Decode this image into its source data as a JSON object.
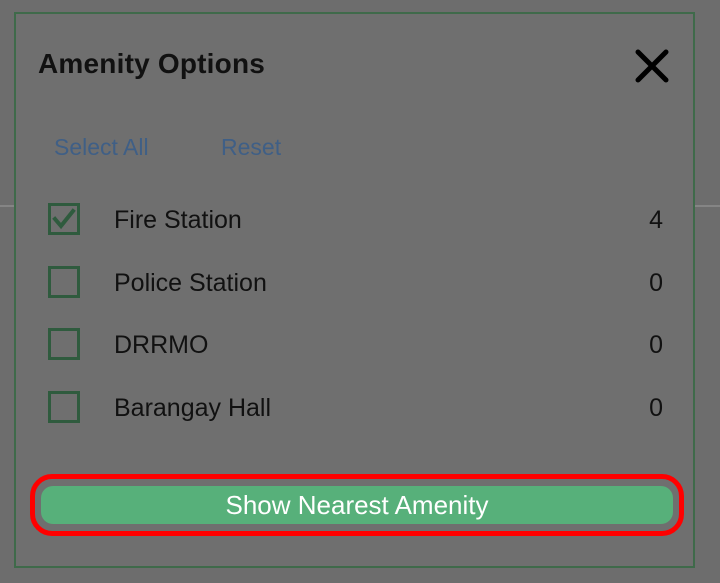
{
  "dialog": {
    "title": "Amenity Options",
    "select_all_label": "Select All",
    "reset_label": "Reset",
    "items": [
      {
        "label": "Fire Station",
        "count": "4",
        "checked": true
      },
      {
        "label": "Police Station",
        "count": "0",
        "checked": false
      },
      {
        "label": "DRRMO",
        "count": "0",
        "checked": false
      },
      {
        "label": "Barangay Hall",
        "count": "0",
        "checked": false
      }
    ],
    "action_label": "Show Nearest Amenity"
  },
  "colors": {
    "accent": "#57b07a",
    "checkbox_border": "#2f5b3e",
    "link": "#3f5f86",
    "highlight": "#ff0000"
  },
  "icons": {
    "close": "close-icon",
    "check": "check-icon"
  }
}
